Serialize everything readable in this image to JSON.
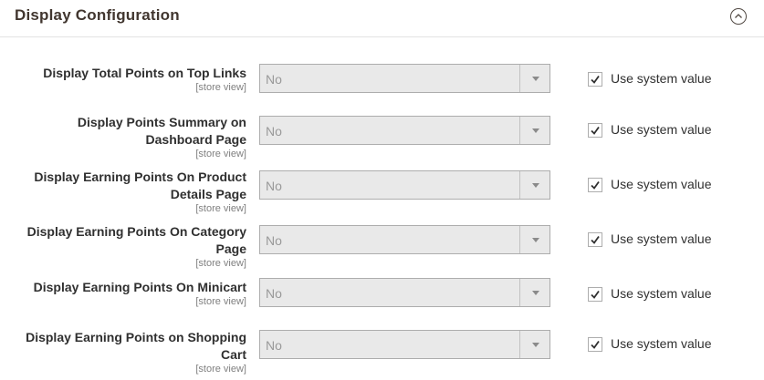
{
  "section": {
    "title": "Display Configuration"
  },
  "rows": [
    {
      "label": "Display Total Points on Top Links",
      "scope": "[store view]",
      "value": "No",
      "use_system_label": "Use system value",
      "checked": true
    },
    {
      "label": "Display Points Summary on Dashboard Page",
      "scope": "[store view]",
      "value": "No",
      "use_system_label": "Use system value",
      "checked": true
    },
    {
      "label": "Display Earning Points On Product Details Page",
      "scope": "[store view]",
      "value": "No",
      "use_system_label": "Use system value",
      "checked": true
    },
    {
      "label": "Display Earning Points On Category Page",
      "scope": "[store view]",
      "value": "No",
      "use_system_label": "Use system value",
      "checked": true
    },
    {
      "label": "Display Earning Points On Minicart",
      "scope": "[store view]",
      "value": "No",
      "use_system_label": "Use system value",
      "checked": true
    },
    {
      "label": "Display Earning Points on Shopping Cart",
      "scope": "[store view]",
      "value": "No",
      "use_system_label": "Use system value",
      "checked": true
    }
  ],
  "icons": {
    "collapse": "chevron-up-circle-icon",
    "dropdown": "chevron-down-icon",
    "check": "check-icon"
  },
  "colors": {
    "disabled_select_bg": "#e9e9e9",
    "border": "#adadad",
    "title": "#41362f"
  }
}
